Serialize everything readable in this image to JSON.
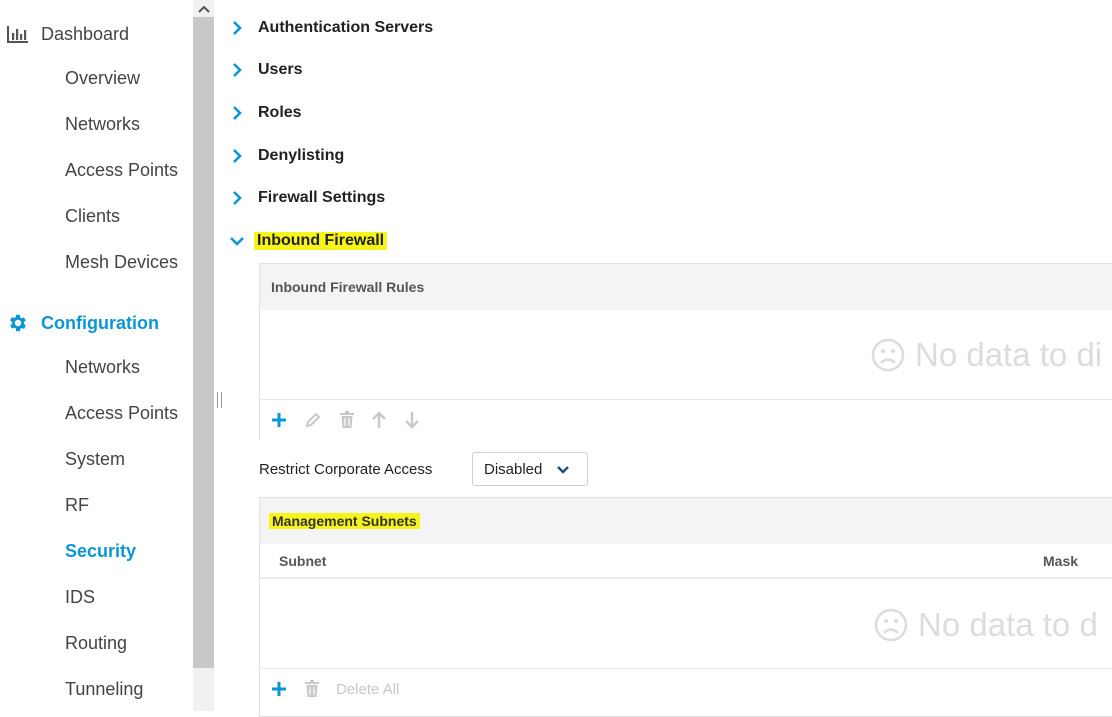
{
  "sidebar": {
    "dashboard": {
      "label": "Dashboard",
      "icon": "bar-chart-icon",
      "items": [
        {
          "label": "Overview"
        },
        {
          "label": "Networks"
        },
        {
          "label": "Access Points"
        },
        {
          "label": "Clients"
        },
        {
          "label": "Mesh Devices"
        }
      ]
    },
    "configuration": {
      "label": "Configuration",
      "icon": "gear-icon",
      "items": [
        {
          "label": "Networks"
        },
        {
          "label": "Access Points"
        },
        {
          "label": "System"
        },
        {
          "label": "RF"
        },
        {
          "label": "Security",
          "active": true
        },
        {
          "label": "IDS"
        },
        {
          "label": "Routing"
        },
        {
          "label": "Tunneling"
        }
      ]
    }
  },
  "accordion": [
    {
      "title": "Authentication Servers",
      "expanded": false
    },
    {
      "title": "Users",
      "expanded": false
    },
    {
      "title": "Roles",
      "expanded": false
    },
    {
      "title": "Denylisting",
      "expanded": false
    },
    {
      "title": "Firewall Settings",
      "expanded": false
    },
    {
      "title": "Inbound Firewall",
      "expanded": true,
      "highlighted": true
    }
  ],
  "inbound_rules": {
    "title": "Inbound Firewall Rules",
    "empty_text": "No data to di"
  },
  "restrict": {
    "label": "Restrict Corporate Access",
    "value": "Disabled"
  },
  "management_subnets": {
    "title": "Management Subnets",
    "columns": [
      "Subnet",
      "Mask"
    ],
    "empty_text": "No data to d",
    "delete_all_label": "Delete All"
  },
  "colors": {
    "accent": "#0b96d4",
    "highlight": "#f7f41c",
    "disabled_icon": "#c8c8c8"
  }
}
